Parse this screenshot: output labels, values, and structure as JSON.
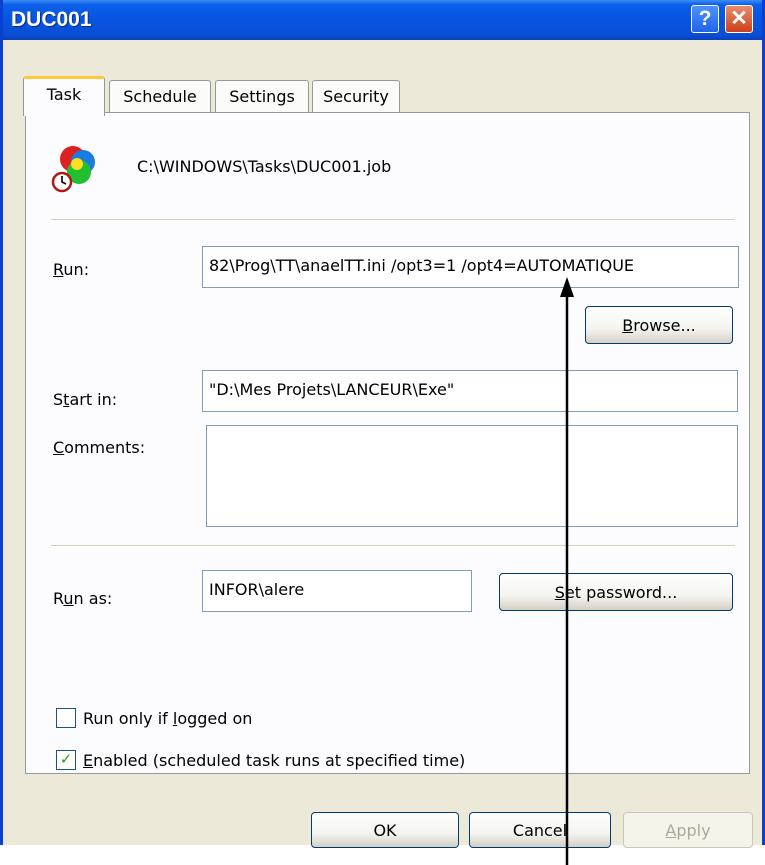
{
  "window": {
    "title": "DUC001"
  },
  "titlebar": {
    "help_glyph": "?",
    "close_glyph": "✕"
  },
  "tabs": [
    {
      "label": "Task",
      "active": true
    },
    {
      "label": "Schedule",
      "active": false
    },
    {
      "label": "Settings",
      "active": false
    },
    {
      "label": "Security",
      "active": false
    }
  ],
  "task": {
    "file_path": "C:\\WINDOWS\\Tasks\\DUC001.job",
    "icon": "scheduled-task-icon",
    "run": {
      "label_u": "R",
      "label_rest": "un:",
      "value": "82\\Prog\\TT\\anaelTT.ini /opt3=1 /opt4=AUTOMATIQUE"
    },
    "browse_button": {
      "label_u": "B",
      "label_rest": "rowse..."
    },
    "start_in": {
      "label_pre": "S",
      "label_u": "t",
      "label_rest": "art in:",
      "value": "\"D:\\Mes Projets\\LANCEUR\\Exe\""
    },
    "comments": {
      "label_u": "C",
      "label_rest": "omments:",
      "value": ""
    },
    "run_as": {
      "label_pre": "R",
      "label_u": "u",
      "label_rest": "n as:",
      "value": "INFOR\\alere"
    },
    "set_password_button": {
      "label_u": "S",
      "label_rest": "et password..."
    },
    "run_only_logged_on": {
      "label_pre": "Run only if ",
      "label_u": "l",
      "label_rest": "ogged on",
      "checked": false
    },
    "enabled": {
      "label_u": "E",
      "label_rest": "nabled (scheduled task runs at specified time)",
      "checked": true
    }
  },
  "footer": {
    "ok": "OK",
    "cancel": "Cancel",
    "apply_u": "A",
    "apply_rest": "pply"
  },
  "colors": {
    "titlebar": "#0854e0",
    "face": "#ece9d8",
    "tab_highlight": "#ffc83c",
    "check": "#21a121"
  }
}
